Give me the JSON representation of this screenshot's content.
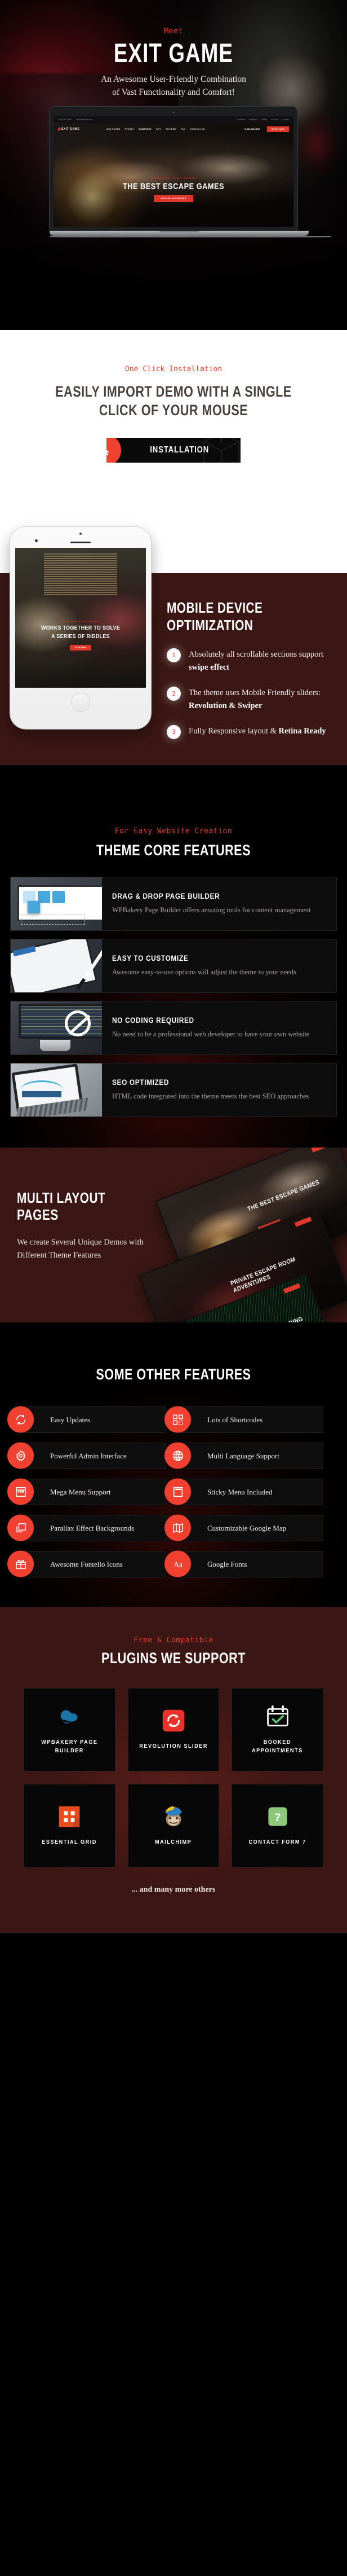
{
  "hero": {
    "kicker": "Meet",
    "title": "EXIT GAME",
    "subtitle_line1": "An Awesome User-Friendly Combination",
    "subtitle_line2": "of Vast Functionality  and Comfort!",
    "mock": {
      "topbar_phone": "+1 800-123-4567",
      "topbar_email": "info@example.com",
      "social": [
        "Facebook",
        "Instagram",
        "Twitter",
        "YouTube",
        "Google+"
      ],
      "logo": "EXIT GAME",
      "logo_sub": "ESCAPE ROOM",
      "menu": [
        "OUR ROOMS",
        "EVENTS",
        "HOMEPAGE",
        "GIFT",
        "REVIEWS",
        "FAQ",
        "CONTACT US"
      ],
      "phone": "+1 800-525-4567",
      "cta": "BOOK NOW",
      "slide_kicker": "An Alternative Leisure Activity!",
      "slide_title": "THE BEST ESCAPE GAMES",
      "slide_button": "CHOOSE ADVENTURE"
    }
  },
  "install": {
    "kicker": "One Click Installation",
    "title_line1": "EASILY IMPORT DEMO WITH A SINGLE",
    "title_line2": "CLICK OF YOUR MOUSE",
    "button_label": "INSTALLATION"
  },
  "mobile": {
    "title_line1": "MOBILE DEVICE",
    "title_line2": "OPTIMIZATION",
    "items": [
      {
        "num": "1",
        "text": "Absolutely all scrollable sections support ",
        "bold": "swipe effect",
        "after": ""
      },
      {
        "num": "2",
        "text": "The theme uses Mobile Friendly sliders: ",
        "bold": "Revolution & Swiper",
        "after": ""
      },
      {
        "num": "3",
        "text": "Fully Responsive layout & ",
        "bold": "Retina Ready",
        "after": ""
      }
    ],
    "phone_slide_kicker": "Whole Team Works Together",
    "phone_slide_title_1": "WORKS TOGETHER TO SOLVE",
    "phone_slide_title_2": "A SERIES OF  RIDDLES",
    "phone_slide_button": "PLAY NOW"
  },
  "core": {
    "kicker": "For Easy Website Creation",
    "title": "THEME CORE FEATURES",
    "features": [
      {
        "heading": "DRAG & DROP PAGE BUILDER",
        "text": "WPBakery Page Builder offers amazing tools for content management",
        "thumb": "laptop-widgets-thumb"
      },
      {
        "heading": "EASY TO CUSTOMIZE",
        "text": "Awesome easy-to-use options will adjust the theme to your needs",
        "thumb": "tablet-stylus-thumb"
      },
      {
        "heading": "NO CODING REQUIRED",
        "text": "No need to be a professional web developer to have your own website",
        "thumb": "imac-code-thumb"
      },
      {
        "heading": "SEO OPTIMIZED",
        "text": "HTML code integrated into the theme meets the best SEO approaches",
        "thumb": "tablet-analytics-thumb"
      }
    ]
  },
  "multi": {
    "title_line1": "MULTI LAYOUT",
    "title_line2": "PAGES",
    "description": "We create Several Unique Demos with Different Theme Features",
    "shot_titles": [
      "THE BEST ESCAPE GAMES",
      "PRIVATE ESCAPE ROOM ADVENTURES",
      "A NEW DE CORPORA BUILDING"
    ]
  },
  "other": {
    "title": "SOME OTHER FEATURES",
    "items": [
      {
        "label": "Easy Updates",
        "icon": "refresh-icon"
      },
      {
        "label": "Lots of Shortcodes",
        "icon": "grid-blocks-icon"
      },
      {
        "label": "Powerful Admin Interface",
        "icon": "gear-icon"
      },
      {
        "label": "Multi Language Support",
        "icon": "globe-icon"
      },
      {
        "label": "Mega Menu Support",
        "icon": "mega-menu-icon"
      },
      {
        "label": "Sticky Menu Included",
        "icon": "sticky-menu-icon"
      },
      {
        "label": "Parallax Effect Backgrounds",
        "icon": "layers-icon"
      },
      {
        "label": "Customizable Google Map",
        "icon": "map-icon"
      },
      {
        "label": "Awesome Fontello Icons",
        "icon": "gift-icon"
      },
      {
        "label": "Google Fonts",
        "icon": "typography-aa-icon"
      }
    ]
  },
  "plugins": {
    "kicker": "Free & Compatible",
    "title": "PLUGINS WE SUPPORT",
    "items": [
      {
        "name": "WPBAKERY PAGE BUILDER",
        "icon": "wpbakery-logo"
      },
      {
        "name": "REVOLUTION SLIDER",
        "icon": "revolution-slider-logo"
      },
      {
        "name": "BOOKED APPOINTMENTS",
        "icon": "calendar-check-logo"
      },
      {
        "name": "ESSENTIAL GRID",
        "icon": "essential-grid-logo"
      },
      {
        "name": "MAILCHIMP",
        "icon": "mailchimp-logo"
      },
      {
        "name": "CONTACT FORM 7",
        "icon": "contact-form-7-logo"
      }
    ],
    "footer_note": "... and many more others"
  },
  "colors": {
    "accent": "#ef4030",
    "maroon": "#3a1714",
    "black": "#000000",
    "white": "#ffffff",
    "dark_text": "#4a403c"
  }
}
